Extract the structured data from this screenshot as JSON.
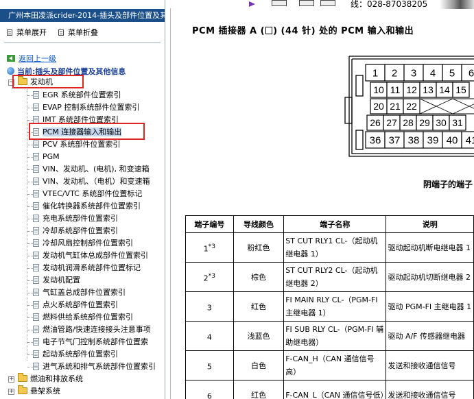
{
  "window": {
    "title": "广州本田凌派crider-2014-插头及部件位置及其"
  },
  "toolbar": {
    "expand_label": "菜单展开",
    "collapse_label": "菜单折叠"
  },
  "nav": {
    "back_label": "返回上一级",
    "current_label": "当前:插头及部件位置及其他信息"
  },
  "top_strip": {
    "phone_text": "线：028-87038205"
  },
  "tree": {
    "root": {
      "label": "发动机",
      "children": [
        {
          "label": "EGR 系统部件位置索引"
        },
        {
          "label": "EVAP 控制系统部件位置索引"
        },
        {
          "label": "IMT 系统部件位置索引"
        },
        {
          "label": "PCM 连接器输入和输出"
        },
        {
          "label": "PCV 系统部件位置索引"
        },
        {
          "label": "PGM"
        },
        {
          "label": "VIN、发动机、(电机), 和变速箱"
        },
        {
          "label": "VIN、发动机、（电机）和变速箱"
        },
        {
          "label": "VTEC/VTC 系统部件位置标记"
        },
        {
          "label": "催化转换器系统部件位置索引"
        },
        {
          "label": "充电系统部件位置索引"
        },
        {
          "label": "冷却系统部件位置索引"
        },
        {
          "label": "冷却风扇控制部件位置索引"
        },
        {
          "label": "发动机气缸体总成部件位置索引"
        },
        {
          "label": "发动机润滑系统部件位置标记"
        },
        {
          "label": "发动机配置"
        },
        {
          "label": "气缸盖总成部件位置索引"
        },
        {
          "label": "点火系统部件位置索引"
        },
        {
          "label": "燃料供给系统部件位置索引"
        },
        {
          "label": "燃油管路/快速连接接头注意事项"
        },
        {
          "label": "电子节气门控制系统部件位置索"
        },
        {
          "label": "起动系统部件位置索引"
        },
        {
          "label": "进气系统和排气系统部件位置索引"
        }
      ]
    },
    "siblings": [
      {
        "label": "燃油和排放系统"
      },
      {
        "label": "悬架系统"
      }
    ]
  },
  "document": {
    "title_prefix": "PCM 插接器 A (",
    "title_suffix": ") (44 针) 处的 PCM 输入和输出",
    "connector": {
      "row1": [
        "1",
        "2",
        "3",
        "4",
        "5",
        "6"
      ],
      "row2": [
        "10",
        "11",
        "12",
        "13",
        "14",
        "15"
      ],
      "row3": [
        "20",
        "21",
        "22"
      ],
      "row4": [
        "26",
        "27",
        "28",
        "29",
        "30",
        "31"
      ],
      "row5": [
        "36",
        "37",
        "38",
        "39",
        "40",
        "41"
      ],
      "caption": "阴端子的端子"
    },
    "table": {
      "headers": [
        "端子编号",
        "导线颜色",
        "端子名称",
        "说明"
      ],
      "rows": [
        {
          "num": "1",
          "sup": "*3",
          "color": "粉红色",
          "name": "ST CUT RLY1 CL-（起动机继电器 1）",
          "desc": "驱动起动机断电继电器 1"
        },
        {
          "num": "2",
          "sup": "*3",
          "color": "棕色",
          "name": "ST CUT RLY2 CL-（起动机继电器 2）",
          "desc": "驱动起动机切断继电器 2"
        },
        {
          "num": "3",
          "sup": "",
          "color": "红色",
          "name": "FI MAIN RLY CL-（PGM-FI 主继电器 1）",
          "desc": "驱动 PGM-FI 主继电器 1"
        },
        {
          "num": "4",
          "sup": "",
          "color": "浅蓝色",
          "name": "FI SUB RLY CL-（PGM-FI 辅助继电器）",
          "desc": "驱动 A/F 传感器继电器"
        },
        {
          "num": "5",
          "sup": "",
          "color": "白色",
          "name": "F-CAN_H（CAN 通信信号高）",
          "desc": "发送和接收通信信号"
        },
        {
          "num": "6",
          "sup": "",
          "color": "红色",
          "name": "F-CAN_L（CAN 通信信号低）",
          "desc": "发送和接收通信信号"
        }
      ]
    }
  },
  "colors": {
    "title_bar": "#1a4f8a",
    "link": "#0055cc",
    "current": "#1a3f99",
    "highlight_box": "#e02424",
    "selected_bg": "#c6d9f0"
  }
}
